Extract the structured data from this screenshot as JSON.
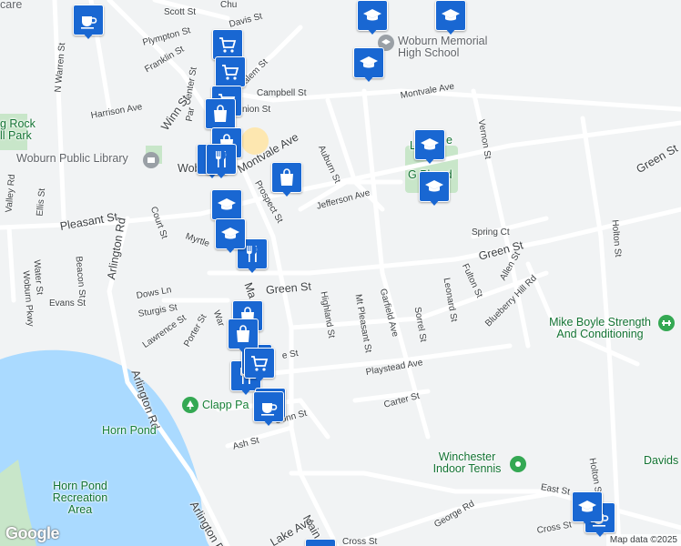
{
  "map": {
    "attribution": "Map data ©2025",
    "logo": "Google"
  },
  "labels": {
    "scott_st": "Scott St",
    "davis_st": "Davis St",
    "church_st": "Chu",
    "plympton_st": "Plympton St",
    "franklin_st": "Franklin St",
    "salem_st": "Salem St",
    "center_st": "Center St",
    "n_warren_st": "N Warren St",
    "campbell_st": "Campbell St",
    "montvale_ave_e": "Montvale Ave",
    "harrison_ave": "Harrison Ave",
    "winn_st": "Winn St",
    "union_st": "nion St",
    "par": "Par",
    "montvale_ave_w": "Montvale Ave",
    "auburn_st": "Auburn St",
    "vernon_st": "Vernon St",
    "green_st_ne": "Green St",
    "library": "Woburn Public Library",
    "woburn_city": "Wob",
    "prospect_st": "Prospect St",
    "jefferson_ave": "Jefferson Ave",
    "valley_rd": "Valley Rd",
    "ellis_st": "Ellis St",
    "court_st": "Court St",
    "pleasant_st": "Pleasant St",
    "arlington_rd": "Arlington Rd",
    "myrtle": "Myrtle",
    "beacon_st": "Beacon St",
    "water_st": "Water St",
    "woburn_pkwy": "Woburn Pkwy",
    "holton_st_n": "Holton St",
    "spring_ct": "Spring Ct",
    "green_st_mid": "Green St",
    "allen_st": "Allen St",
    "fulton_st": "Fulton St",
    "blueberry_hill_rd": "Blueberry Hill Rd",
    "leonard_st": "Leonard St",
    "green_st_w": "Green St",
    "evans_st": "Evans St",
    "dows_ln": "Dows Ln",
    "sturgis_st": "Sturgis St",
    "ma": "Ma",
    "highland_st": "Highland St",
    "mt_pleasant_st": "Mt Pleasant St",
    "garfield_ave": "Garfield Ave",
    "sorrel_st": "Sorrel St",
    "lawrence_st": "Lawrence St",
    "porter_st": "Porter St",
    "war": "War",
    "e_st": "e St",
    "playstead_ave": "Playstead Ave",
    "arlington_rd_s": "Arlington Rd",
    "clapp_park": "Clapp Pa",
    "carter_st": "Carter St",
    "conn_st": "Conn St",
    "ash_st": "Ash St",
    "horn_pond": "Horn Pond",
    "horn_pond_rec": "Horn Pond Recreation Area",
    "east_st": "East St",
    "holton_st_s": "Holton St",
    "main_st": "Main St",
    "lake_ave": "Lake Ave",
    "arlington_rd_s2": "Arlington Road",
    "george_rd": "George Rd",
    "cross_st_w": "Cross St",
    "cross_st_e": "Cross St",
    "care": "care",
    "woburn_memorial": "Woburn Memorial High School",
    "rock_park": "g Rock ll Park",
    "l_park": "L",
    "e_label": "e",
    "g_play": "G Pla nd",
    "mike_boyle": "Mike Boyle Strength And Conditioning",
    "winchester_tennis": "Winchester Indoor Tennis",
    "davids": "Davids"
  },
  "pins": [
    {
      "icon": "coffee-icon",
      "name": "coffee"
    },
    {
      "icon": "school-icon",
      "name": "school"
    },
    {
      "icon": "school-icon",
      "name": "school"
    },
    {
      "icon": "school-icon",
      "name": "school"
    },
    {
      "icon": "school-icon",
      "name": "school"
    },
    {
      "icon": "school-icon",
      "name": "school"
    },
    {
      "icon": "cart-icon",
      "name": "grocery"
    },
    {
      "icon": "cart-icon",
      "name": "grocery"
    },
    {
      "icon": "cart-icon",
      "name": "grocery"
    },
    {
      "icon": "bag-icon",
      "name": "shopping"
    },
    {
      "icon": "bag-icon",
      "name": "shopping"
    },
    {
      "icon": "bag-icon",
      "name": "shopping"
    },
    {
      "icon": "bag-icon",
      "name": "shopping"
    },
    {
      "icon": "restaurant-icon",
      "name": "restaurant"
    },
    {
      "icon": "restaurant-icon",
      "name": "restaurant"
    },
    {
      "icon": "restaurant-icon",
      "name": "restaurant"
    },
    {
      "icon": "coffee-icon",
      "name": "coffee"
    },
    {
      "icon": "coffee-icon",
      "name": "coffee"
    },
    {
      "icon": "school-icon",
      "name": "school"
    },
    {
      "icon": "cart-icon",
      "name": "grocery"
    }
  ],
  "colors": {
    "marker": "#1967d2",
    "water": "#aadaff",
    "park": "#c8e6c9",
    "road": "#ffffff",
    "background": "#f1f3f4"
  }
}
